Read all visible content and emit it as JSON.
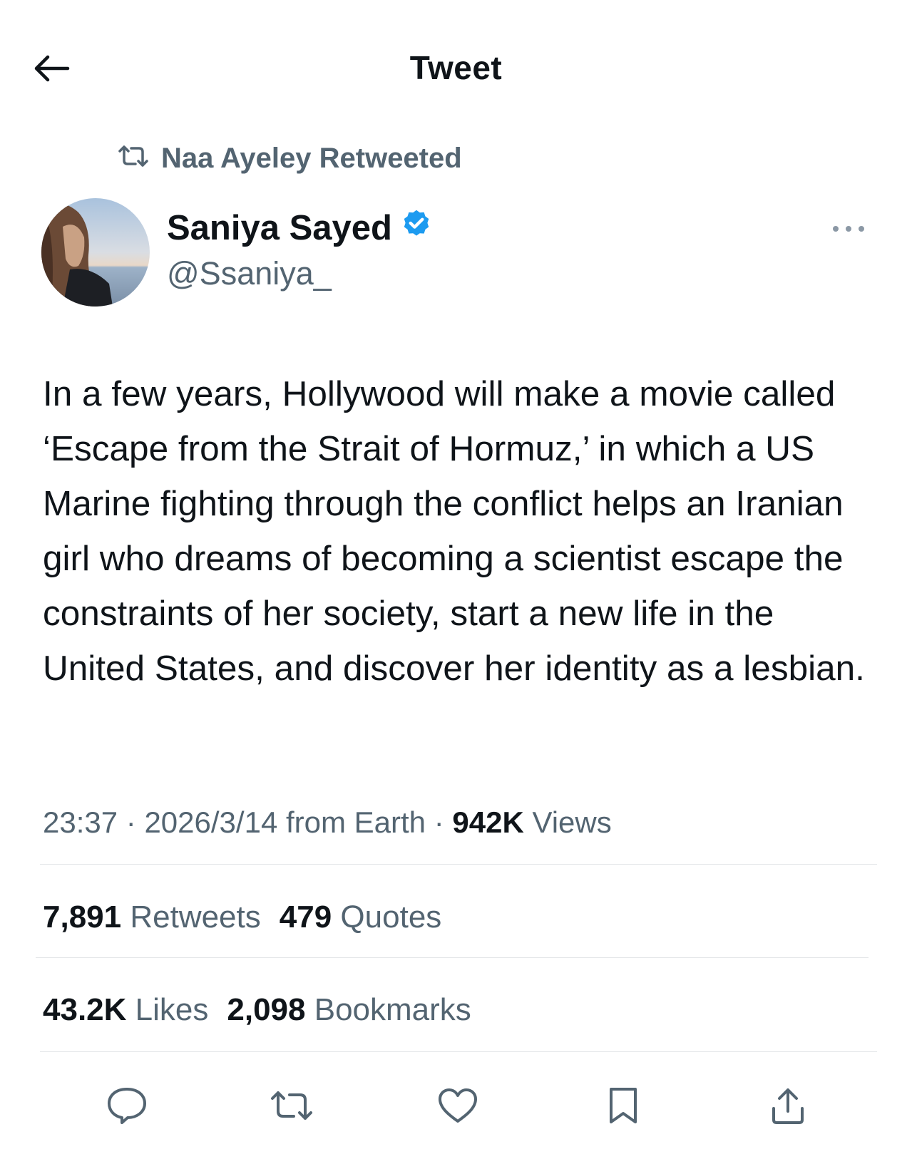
{
  "header": {
    "title": "Tweet"
  },
  "retweet_context": {
    "text": "Naa Ayeley Retweeted"
  },
  "author": {
    "name": "Saniya Sayed",
    "handle": "@Ssaniya_",
    "verified": true
  },
  "tweet": {
    "text": "In a few years, Hollywood will make a movie called ‘Escape from the Strait of Hormuz,’ in which a US Marine fighting through the conflict helps an Iranian girl who dreams of becoming a scientist escape the constraints of her society, start a new life in the United States, and discover her identity as a lesbian."
  },
  "meta": {
    "time": "23:37",
    "date": "2026/3/14",
    "source": "from Earth",
    "separator": "·",
    "views_count": "942K",
    "views_label": "Views"
  },
  "stats": {
    "retweets_count": "7,891",
    "retweets_label": "Retweets",
    "quotes_count": "479",
    "quotes_label": "Quotes",
    "likes_count": "43.2K",
    "likes_label": "Likes",
    "bookmarks_count": "2,098",
    "bookmarks_label": "Bookmarks"
  },
  "icons": [
    "back-arrow-icon",
    "retweet-icon",
    "verified-badge-icon",
    "more-icon",
    "reply-icon",
    "retweet-icon",
    "like-icon",
    "bookmark-icon",
    "share-icon"
  ],
  "colors": {
    "verified": "#1d9bf0",
    "text": "#0f1419",
    "secondary": "#536471",
    "divider": "#e3e6e8"
  }
}
